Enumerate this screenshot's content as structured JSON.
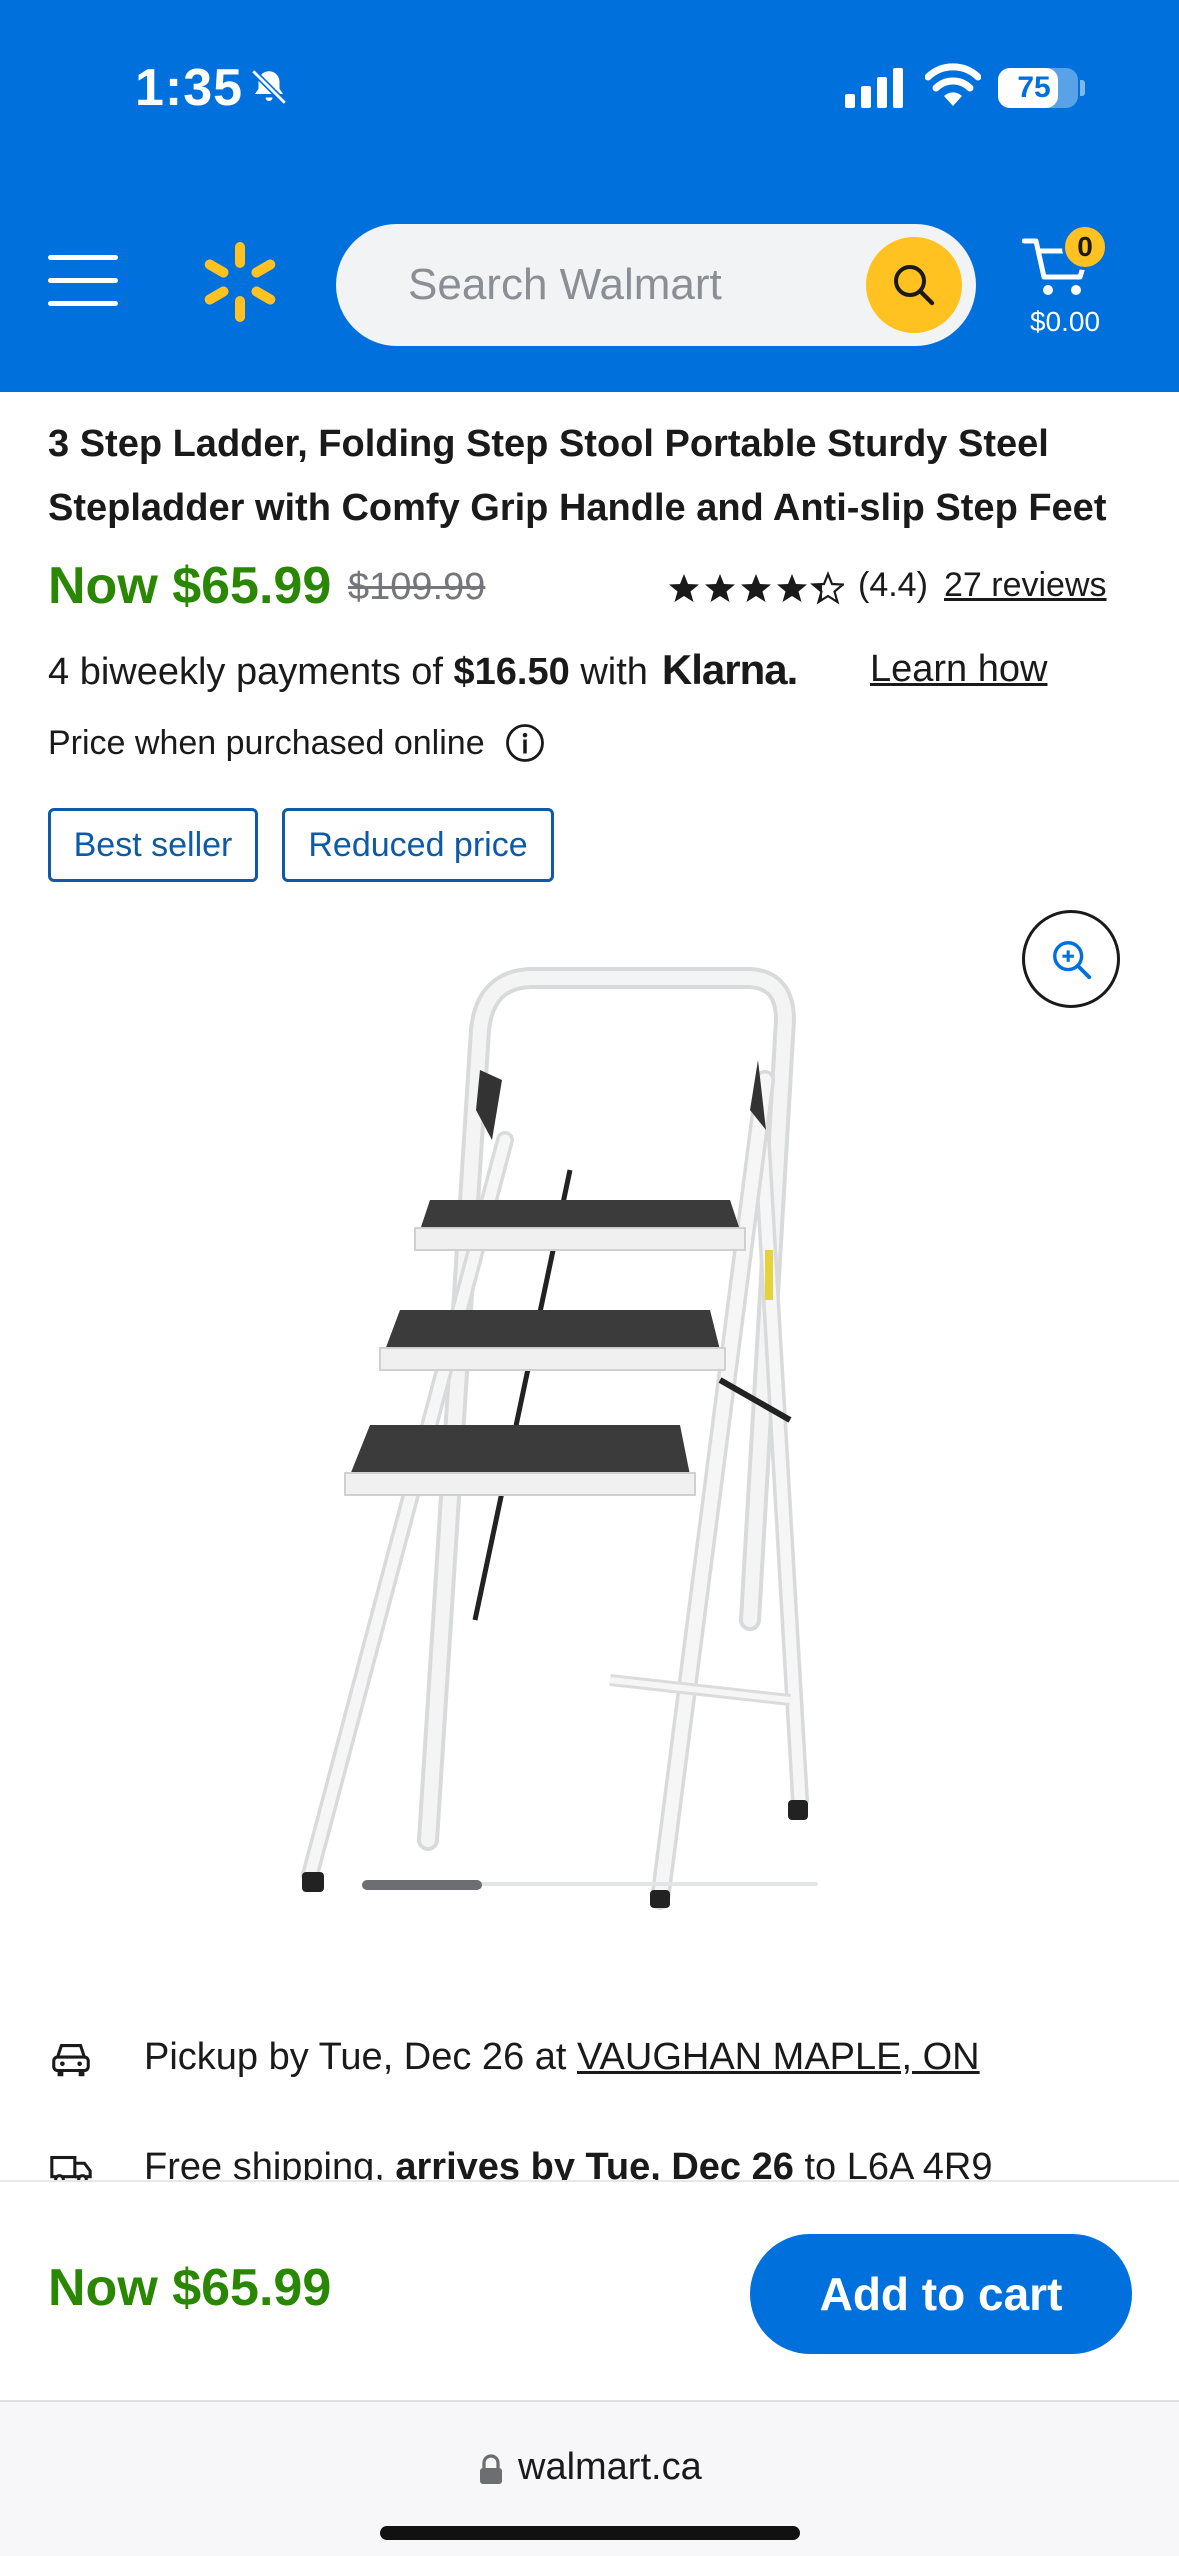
{
  "status_bar": {
    "time": "1:35",
    "battery": "75",
    "battery_level": 0.75
  },
  "header": {
    "search_placeholder": "Search Walmart",
    "cart_count": "0",
    "cart_total": "$0.00",
    "colors": {
      "brand_blue": "#0071dc",
      "spark_yellow": "#ffc220"
    }
  },
  "product": {
    "title": "3 Step Ladder, Folding Step Stool Portable Sturdy Steel Stepladder with Comfy Grip Handle and Anti-slip Step Feet",
    "now_price": "Now $65.99",
    "was_price": "$109.99",
    "rating_value": 4.4,
    "rating_text": "(4.4)",
    "reviews_text": "27 reviews",
    "klarna": {
      "prefix": "4 biweekly payments of ",
      "amount": "$16.50",
      "suffix": " with",
      "brand": "Klarna.",
      "learn_how": "Learn how"
    },
    "price_note": "Price when purchased online",
    "badges": [
      "Best seller",
      "Reduced price"
    ],
    "image_count_position": 1
  },
  "fulfillment": {
    "pickup_prefix": "Pickup by Tue, Dec 26 at ",
    "pickup_store": "VAUGHAN MAPLE, ON",
    "shipping_prefix": "Free shipping, ",
    "shipping_bold": "arrives by Tue, Dec 26",
    "shipping_mid": " to ",
    "shipping_postal": "L6A 4R9"
  },
  "bottom_bar": {
    "price": "Now $65.99",
    "add_to_cart": "Add to cart",
    "price_color": "#2a8703"
  },
  "browser": {
    "url": "walmart.ca"
  }
}
